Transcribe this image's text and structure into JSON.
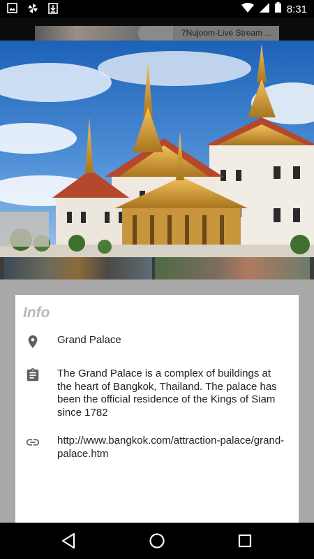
{
  "status_bar": {
    "time": "8:31",
    "icons_left": [
      "image-notification-icon",
      "pinwheel-app-icon",
      "download-icon"
    ],
    "icons_right": [
      "wifi-icon",
      "cell-signal-icon",
      "battery-icon"
    ]
  },
  "ad": {
    "text": "7Nujoom-Live Stream ..."
  },
  "hero": {
    "subject": "Grand Palace, Bangkok"
  },
  "info": {
    "heading": "Info",
    "location": "Grand Palace",
    "description": "The Grand Palace is a complex of buildings at the heart of Bangkok, Thailand. The palace has been the official residence of the Kings of Siam since 1782",
    "url": "http://www.bangkok.com/attraction-palace/grand-palace.htm",
    "icons": [
      "location-pin-icon",
      "clipboard-icon",
      "link-icon"
    ]
  },
  "nav": {
    "buttons": [
      "back-button",
      "home-button",
      "recents-button"
    ]
  },
  "colors": {
    "status_bar": "#000000",
    "dim_overlay": "#a9a9a9",
    "card_bg": "#ffffff",
    "heading": "#b9b9b9",
    "icon_gray": "#616161",
    "text": "#222222"
  }
}
